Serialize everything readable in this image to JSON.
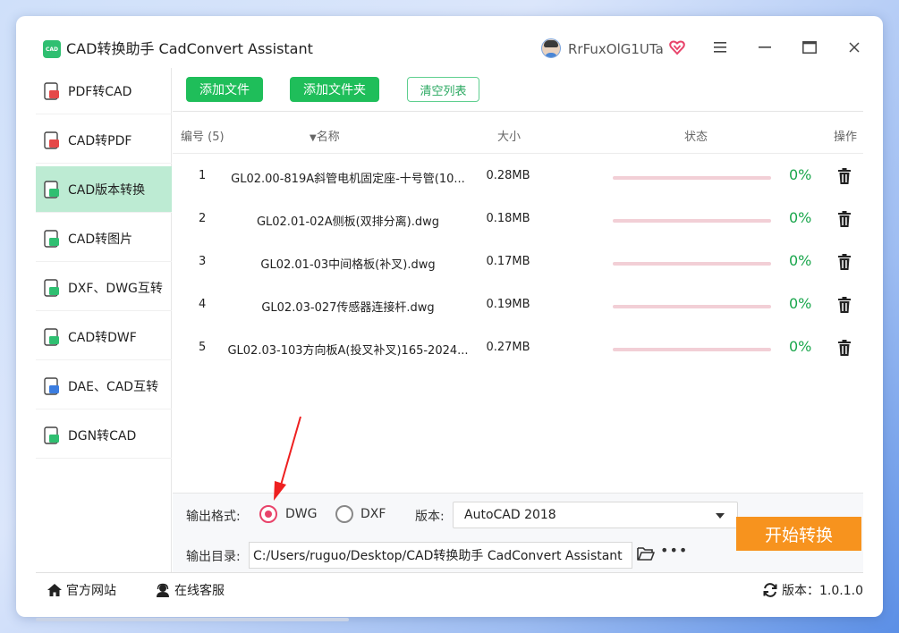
{
  "window": {
    "logo_text": "CAD",
    "title": "CAD转换助手 CadConvert Assistant",
    "username": "RrFuxOlG1UTa"
  },
  "sidebar": {
    "items": [
      {
        "label": "PDF转CAD",
        "icon": "pdf-icon",
        "active": false
      },
      {
        "label": "CAD转PDF",
        "icon": "pdf-icon",
        "active": false
      },
      {
        "label": "CAD版本转换",
        "icon": "version-icon",
        "active": true
      },
      {
        "label": "CAD转图片",
        "icon": "image-icon",
        "active": false
      },
      {
        "label": "DXF、DWG互转",
        "icon": "file-icon",
        "active": false
      },
      {
        "label": "CAD转DWF",
        "icon": "file-icon",
        "active": false
      },
      {
        "label": "DAE、CAD互转",
        "icon": "file-icon",
        "active": false
      },
      {
        "label": "DGN转CAD",
        "icon": "file-icon",
        "active": false
      }
    ]
  },
  "toolbar": {
    "add_file": "添加文件",
    "add_folder": "添加文件夹",
    "clear_list": "清空列表"
  },
  "table": {
    "headers": {
      "num": "编号 (5)",
      "name": "名称",
      "size": "大小",
      "status": "状态",
      "action": "操作"
    },
    "rows": [
      {
        "num": "1",
        "name": "GL02.00-819A斜管电机固定座-十号管(10...",
        "size": "0.28MB",
        "progress": 0,
        "percent": "0%"
      },
      {
        "num": "2",
        "name": "GL02.01-02A侧板(双排分离).dwg",
        "size": "0.18MB",
        "progress": 0,
        "percent": "0%"
      },
      {
        "num": "3",
        "name": "GL02.01-03中间格板(补叉).dwg",
        "size": "0.17MB",
        "progress": 0,
        "percent": "0%"
      },
      {
        "num": "4",
        "name": "GL02.03-027传感器连接杆.dwg",
        "size": "0.19MB",
        "progress": 0,
        "percent": "0%"
      },
      {
        "num": "5",
        "name": "GL02.03-103方向板A(投叉补叉)165-2024...",
        "size": "0.27MB",
        "progress": 0,
        "percent": "0%"
      }
    ]
  },
  "output": {
    "format_label": "输出格式:",
    "format_options": [
      "DWG",
      "DXF"
    ],
    "format_selected": "DWG",
    "version_label": "版本:",
    "version_value": "AutoCAD 2018",
    "dir_label": "输出目录:",
    "dir_value": "C:/Users/ruguo/Desktop/CAD转换助手 CadConvert Assistant",
    "start_button": "开始转换"
  },
  "footer": {
    "website": "官方网站",
    "support": "在线客服",
    "version": "版本：1.0.1.0"
  },
  "colors": {
    "accent_green": "#1fbe5a",
    "active_bg": "#bdebd3",
    "start_orange": "#f7931e",
    "radio_pink": "#e8436a",
    "progress_track": "#f2cfd6"
  }
}
